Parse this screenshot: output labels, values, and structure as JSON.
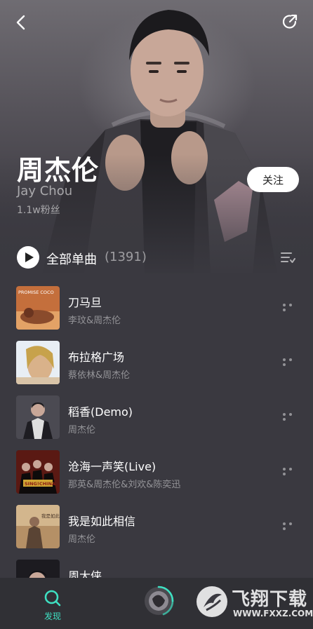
{
  "artist": {
    "name": "周杰伦",
    "english_name": "Jay Chou",
    "fans": "1.1w粉丝",
    "follow_label": "关注"
  },
  "header": {
    "back_icon": "chevron-left-icon",
    "share_icon": "share-icon"
  },
  "songs_section": {
    "label": "全部单曲",
    "count": "(1391)",
    "play_icon": "play-icon",
    "sort_icon": "sort-list-icon"
  },
  "songs": [
    {
      "title": "刀马旦",
      "artist": "李玟&周杰伦",
      "cover_text": "PROMISE COCO"
    },
    {
      "title": "布拉格广场",
      "artist": "蔡依林&周杰伦"
    },
    {
      "title": "稻香(Demo)",
      "artist": "周杰伦"
    },
    {
      "title": "沧海一声笑(Live)",
      "artist": "那英&周杰伦&刘欢&陈奕迅",
      "cover_text": "SING!CHINA"
    },
    {
      "title": "我是如此相信",
      "artist": "周杰伦",
      "cover_text": "我是如此相信"
    },
    {
      "title": "周大侠",
      "artist": ""
    }
  ],
  "tabbar": {
    "discover_label": "发现",
    "accent_color": "#3ee0c2"
  },
  "watermark": {
    "title": "飞翔下载",
    "url": "WWW.FXXZ.COM"
  }
}
